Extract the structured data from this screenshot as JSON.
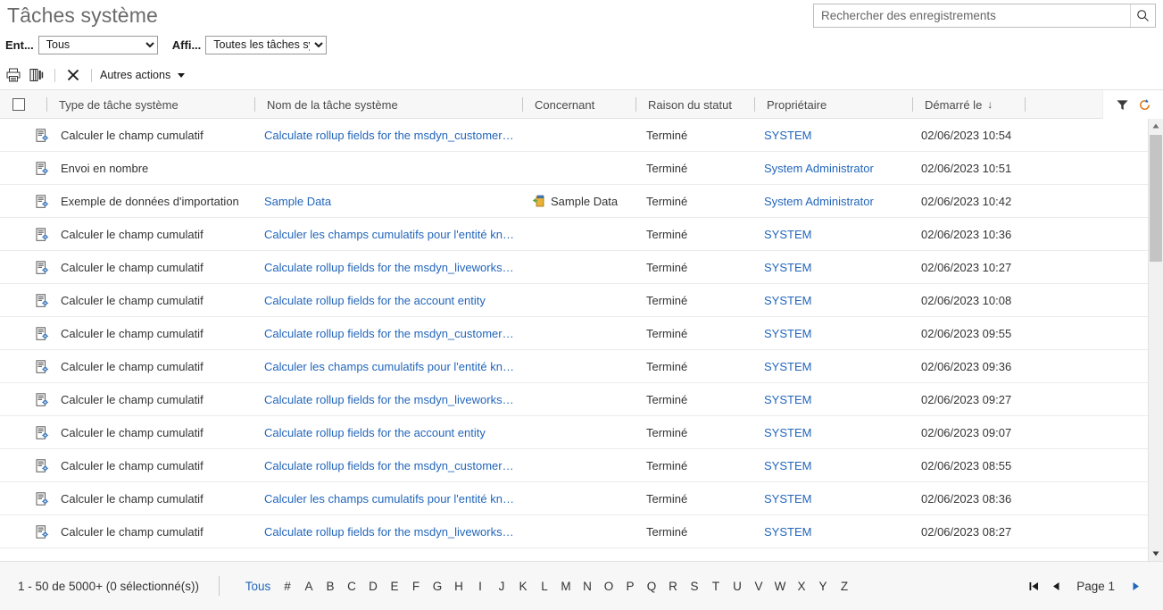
{
  "header": {
    "title": "Tâches système",
    "search": {
      "placeholder": "Rechercher des enregistrements",
      "value": "",
      "icon": "search-icon"
    }
  },
  "filters": {
    "entity": {
      "label": "Ent...",
      "value": "Tous",
      "options": [
        "Tous"
      ]
    },
    "view": {
      "label": "Affi...",
      "value": "Toutes les tâches systè",
      "options": [
        "Toutes les tâches systè"
      ]
    }
  },
  "commandbar": {
    "print_icon": "print-icon",
    "export_excel_icon": "export-excel-icon",
    "delete_icon": "delete-x-icon",
    "more_actions_label": "Autres actions",
    "more_actions_caret": "chevron-down-icon"
  },
  "grid": {
    "columns": [
      {
        "key": "type",
        "label": "Type de tâche système"
      },
      {
        "key": "name",
        "label": "Nom de la tâche système"
      },
      {
        "key": "regard",
        "label": "Concernant"
      },
      {
        "key": "status",
        "label": "Raison du statut"
      },
      {
        "key": "owner",
        "label": "Propriétaire"
      },
      {
        "key": "date",
        "label": "Démarré le",
        "sort": "↓"
      }
    ],
    "tools": {
      "filter_icon": "filter-funnel-icon",
      "refresh_icon": "refresh-icon"
    },
    "row_icon": "system-job-icon",
    "regard_icon": "data-import-icon",
    "rows": [
      {
        "type": "Calculer le champ cumulatif",
        "name": "Calculate rollup fields for the msdyn_customeras...",
        "regard": "",
        "status": "Terminé",
        "owner": "SYSTEM",
        "date": "02/06/2023 10:54"
      },
      {
        "type": "Envoi en nombre",
        "name": "",
        "regard": "",
        "status": "Terminé",
        "owner": "System Administrator",
        "date": "02/06/2023 10:51"
      },
      {
        "type": "Exemple de données d'importation",
        "name": "Sample Data",
        "regard": "Sample Data",
        "status": "Terminé",
        "owner": "System Administrator",
        "date": "02/06/2023 10:42"
      },
      {
        "type": "Calculer le champ cumulatif",
        "name": "Calculer les champs cumulatifs pour l'entité kno...",
        "regard": "",
        "status": "Terminé",
        "owner": "SYSTEM",
        "date": "02/06/2023 10:36"
      },
      {
        "type": "Calculer le champ cumulatif",
        "name": "Calculate rollup fields for the msdyn_liveworkstr...",
        "regard": "",
        "status": "Terminé",
        "owner": "SYSTEM",
        "date": "02/06/2023 10:27"
      },
      {
        "type": "Calculer le champ cumulatif",
        "name": "Calculate rollup fields for the account entity",
        "regard": "",
        "status": "Terminé",
        "owner": "SYSTEM",
        "date": "02/06/2023 10:08"
      },
      {
        "type": "Calculer le champ cumulatif",
        "name": "Calculate rollup fields for the msdyn_customeras...",
        "regard": "",
        "status": "Terminé",
        "owner": "SYSTEM",
        "date": "02/06/2023 09:55"
      },
      {
        "type": "Calculer le champ cumulatif",
        "name": "Calculer les champs cumulatifs pour l'entité kno...",
        "regard": "",
        "status": "Terminé",
        "owner": "SYSTEM",
        "date": "02/06/2023 09:36"
      },
      {
        "type": "Calculer le champ cumulatif",
        "name": "Calculate rollup fields for the msdyn_liveworkstr...",
        "regard": "",
        "status": "Terminé",
        "owner": "SYSTEM",
        "date": "02/06/2023 09:27"
      },
      {
        "type": "Calculer le champ cumulatif",
        "name": "Calculate rollup fields for the account entity",
        "regard": "",
        "status": "Terminé",
        "owner": "SYSTEM",
        "date": "02/06/2023 09:07"
      },
      {
        "type": "Calculer le champ cumulatif",
        "name": "Calculate rollup fields for the msdyn_customeras...",
        "regard": "",
        "status": "Terminé",
        "owner": "SYSTEM",
        "date": "02/06/2023 08:55"
      },
      {
        "type": "Calculer le champ cumulatif",
        "name": "Calculer les champs cumulatifs pour l'entité kno...",
        "regard": "",
        "status": "Terminé",
        "owner": "SYSTEM",
        "date": "02/06/2023 08:36"
      },
      {
        "type": "Calculer le champ cumulatif",
        "name": "Calculate rollup fields for the msdyn_liveworkstr...",
        "regard": "",
        "status": "Terminé",
        "owner": "SYSTEM",
        "date": "02/06/2023 08:27"
      }
    ]
  },
  "footer": {
    "record_count": "1 - 50  de 5000+ (0 sélectionné(s))",
    "alpha_index": [
      "Tous",
      "#",
      "A",
      "B",
      "C",
      "D",
      "E",
      "F",
      "G",
      "H",
      "I",
      "J",
      "K",
      "L",
      "M",
      "N",
      "O",
      "P",
      "Q",
      "R",
      "S",
      "T",
      "U",
      "V",
      "W",
      "X",
      "Y",
      "Z"
    ],
    "alpha_active": "Tous",
    "pager": {
      "first_icon": "first-page-icon",
      "prev_icon": "previous-page-icon",
      "page_label": "Page 1",
      "next_icon": "next-page-icon"
    }
  },
  "colors": {
    "link": "#2266bb",
    "title": "#6b6b6b",
    "header_bg": "#f7f7f7",
    "accent": "#2266bb"
  }
}
